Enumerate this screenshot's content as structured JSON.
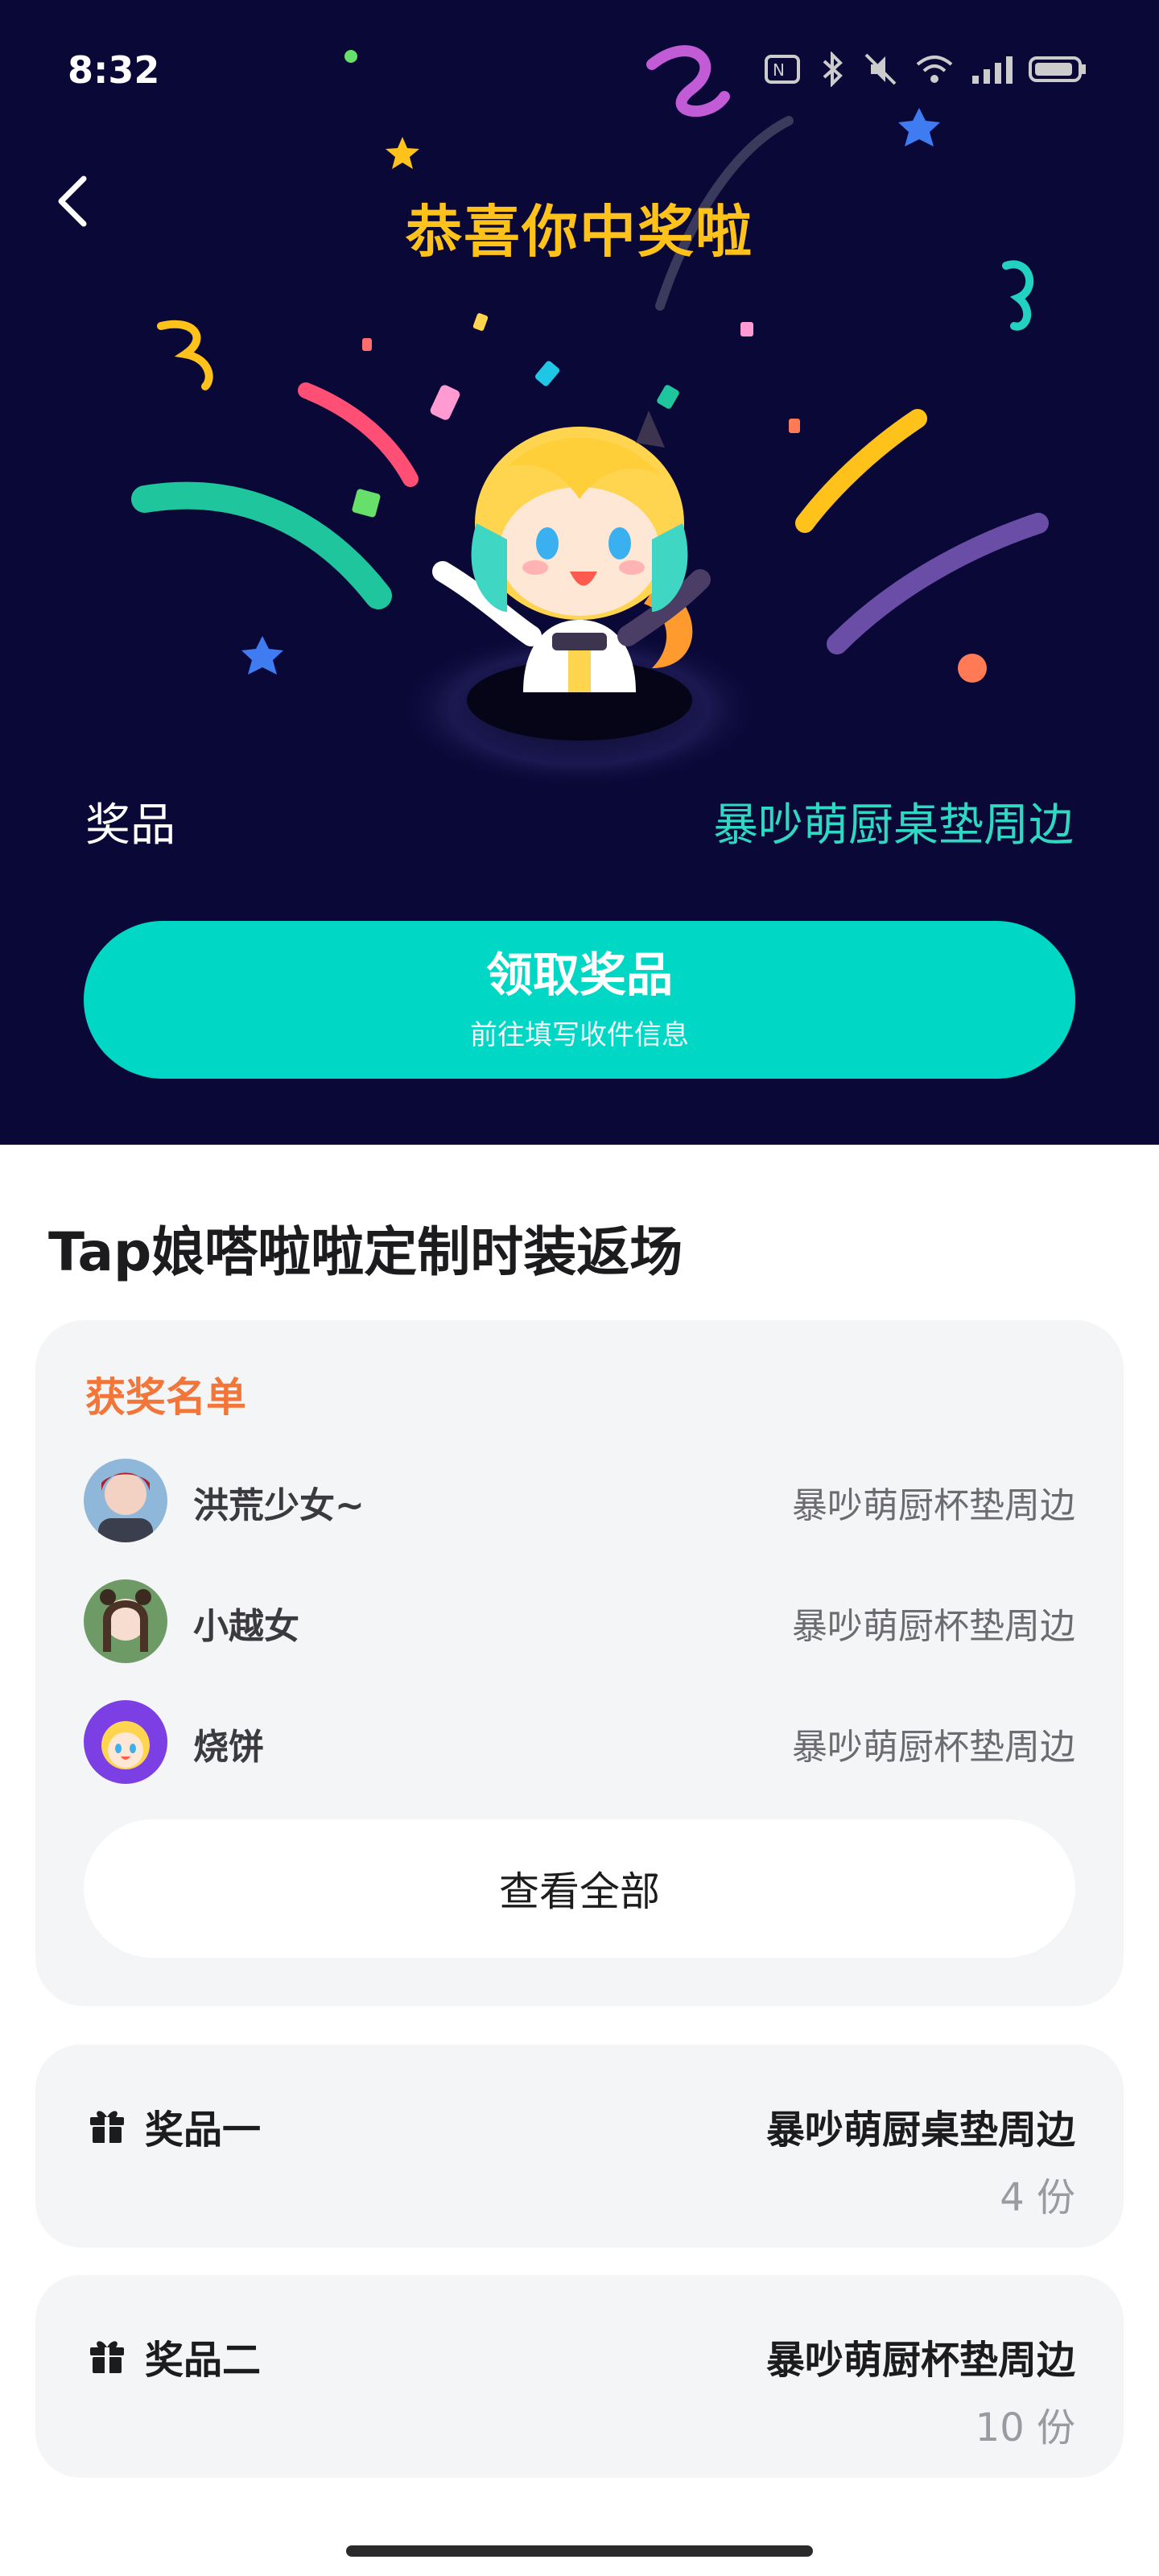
{
  "status_bar": {
    "time": "8:32",
    "icons": [
      "nfc-icon",
      "bluetooth-icon",
      "mute-icon",
      "wifi-icon",
      "signal-icon",
      "battery-icon"
    ]
  },
  "hero": {
    "title": "恭喜你中奖啦",
    "prize_label": "奖品",
    "prize_value": "暴吵萌厨桌垫周边",
    "claim_button": {
      "title": "领取奖品",
      "subtitle": "前往填写收件信息"
    },
    "colors": {
      "background": "#0a0836",
      "title": "#ffc21a",
      "prize_value": "#2fd8c3",
      "button": "#00d7c4"
    }
  },
  "event_title": "Tap娘嗒啦啦定制时装返场",
  "winners": {
    "heading": "获奖名单",
    "rows": [
      {
        "name": "洪荒少女~",
        "prize": "暴吵萌厨杯垫周边"
      },
      {
        "name": "小越女",
        "prize": "暴吵萌厨杯垫周边"
      },
      {
        "name": "烧饼",
        "prize": "暴吵萌厨杯垫周边"
      }
    ],
    "view_all": "查看全部"
  },
  "prize_tiers": [
    {
      "name": "奖品一",
      "prize": "暴吵萌厨桌垫周边",
      "count": "4 份"
    },
    {
      "name": "奖品二",
      "prize": "暴吵萌厨杯垫周边",
      "count": "10 份"
    }
  ]
}
